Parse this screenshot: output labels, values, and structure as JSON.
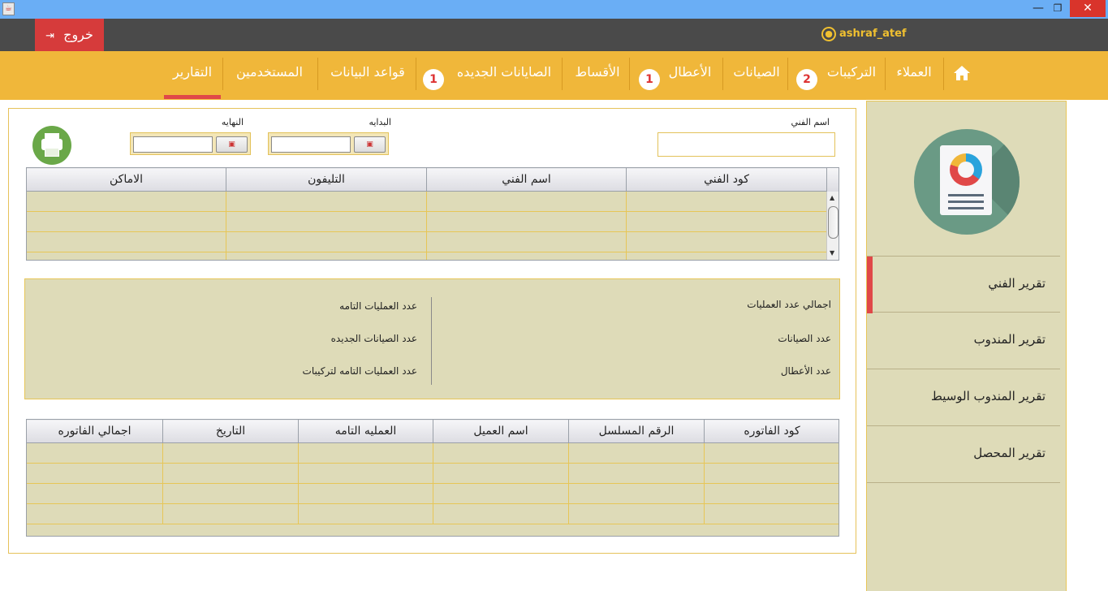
{
  "window": {
    "minimize_glyph": "—",
    "maximize_glyph": "❐",
    "close_glyph": "✕"
  },
  "topbar": {
    "logout_label": "خروج",
    "logout_icon": "exit-icon",
    "username": "ashraf_atef",
    "user_icon": "user-circle-icon"
  },
  "nav": {
    "home_icon": "home-icon",
    "items": [
      {
        "label": "العملاء",
        "badge": ""
      },
      {
        "label": "التركيبات",
        "badge": "2"
      },
      {
        "label": "الصيانات",
        "badge": ""
      },
      {
        "label": "الأعطال",
        "badge": "1"
      },
      {
        "label": "الأقساط",
        "badge": ""
      },
      {
        "label": "الصايانات الجديده",
        "badge": "1"
      },
      {
        "label": "قواعد البيانات",
        "badge": ""
      },
      {
        "label": "المستخدمين",
        "badge": ""
      },
      {
        "label": "التقارير",
        "badge": ""
      }
    ],
    "active": "التقارير",
    "accent_color": "#f0b73a",
    "active_color": "#e04848"
  },
  "filters": {
    "technician_name_label": "اسم الفني",
    "technician_name_value": "",
    "start_label": "البدايه",
    "start_value": "",
    "end_label": "النهايه",
    "end_value": "",
    "print_icon": "printer-icon"
  },
  "technicians_table": {
    "columns": [
      "كود الفني",
      "اسم الفني",
      "التليفون",
      "الاماكن"
    ],
    "rows": [
      [
        "",
        "",
        "",
        ""
      ],
      [
        "",
        "",
        "",
        ""
      ],
      [
        "",
        "",
        "",
        ""
      ],
      [
        "",
        "",
        "",
        ""
      ]
    ]
  },
  "stats": {
    "total_operations": "اجمالي عدد العمليات",
    "completed_operations": "عدد العمليات التامه",
    "maintenance_count": "عدد الصيانات",
    "new_maintenance_count": "عدد الصيانات الجديده",
    "faults_count": "عدد الأعطال",
    "completed_installations": "عدد العمليات التامه لتركيبات"
  },
  "invoices_table": {
    "columns": [
      "كود الفاتوره",
      "الرقم المسلسل",
      "اسم العميل",
      "العمليه التامه",
      "التاريخ",
      "اجمالي الفاتوره"
    ],
    "rows": [
      [
        "",
        "",
        "",
        "",
        "",
        ""
      ],
      [
        "",
        "",
        "",
        "",
        "",
        ""
      ],
      [
        "",
        "",
        "",
        "",
        "",
        ""
      ],
      [
        "",
        "",
        "",
        "",
        "",
        ""
      ]
    ]
  },
  "sidebar": {
    "icon": "report-document-icon",
    "items": [
      {
        "label": "تقرير الفني",
        "active": true
      },
      {
        "label": "تقرير المندوب",
        "active": false
      },
      {
        "label": "تقرير المندوب الوسيط",
        "active": false
      },
      {
        "label": "تقرير المحصل",
        "active": false
      }
    ]
  }
}
